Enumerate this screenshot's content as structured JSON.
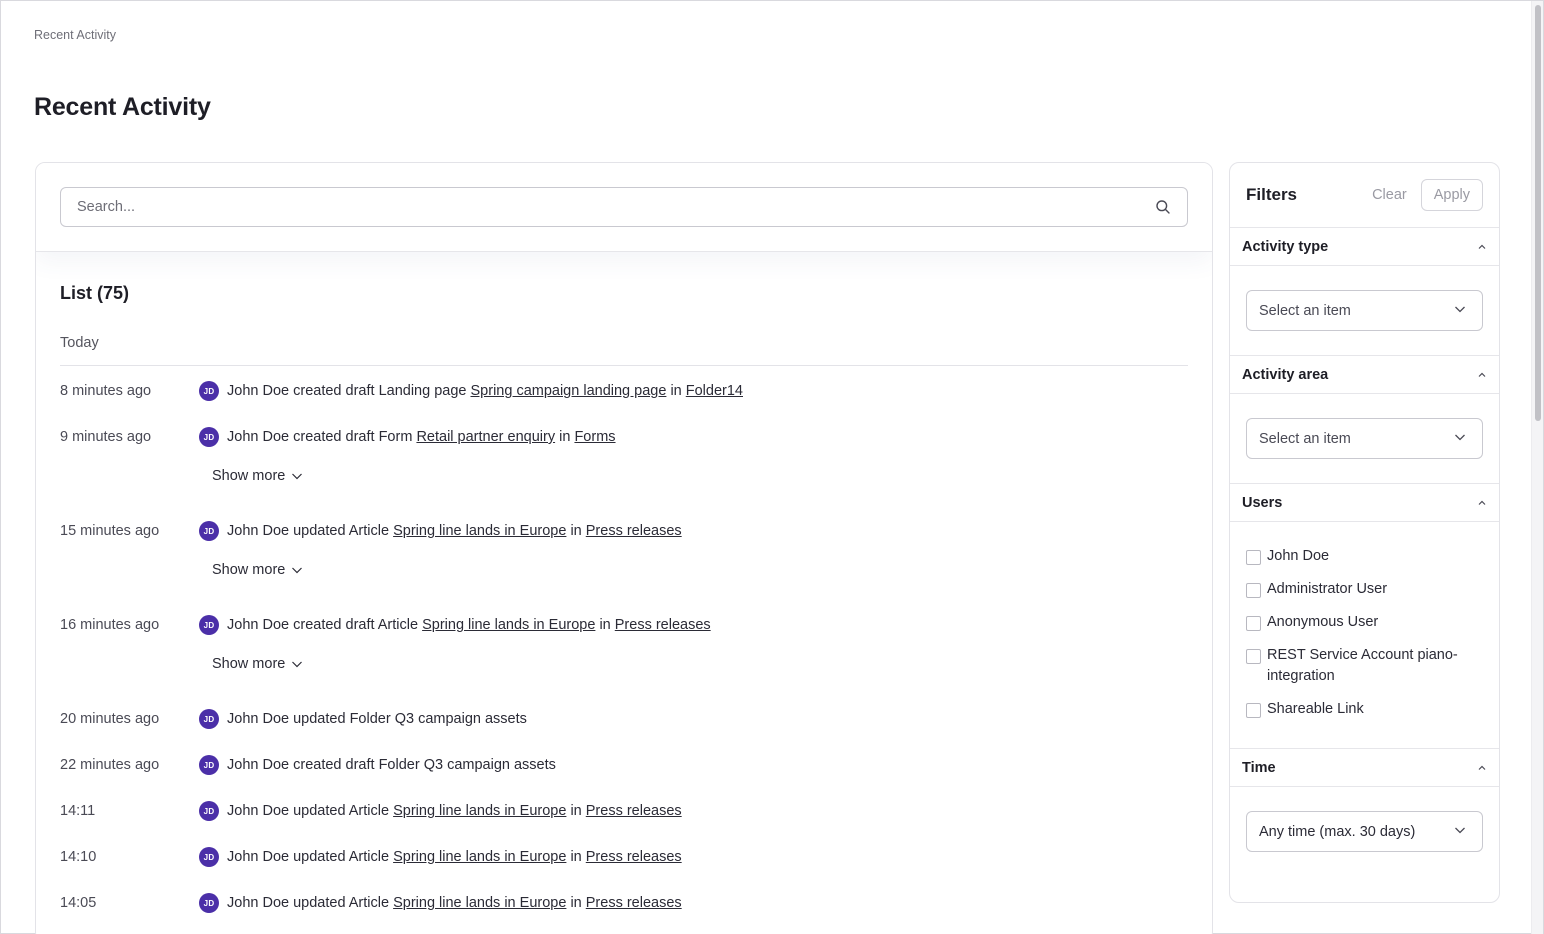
{
  "breadcrumb": "Recent Activity",
  "page_title": "Recent Activity",
  "search": {
    "placeholder": "Search..."
  },
  "list": {
    "title": "List (75)",
    "group": "Today",
    "rows": [
      {
        "time": "8 minutes ago",
        "avatar": "JD",
        "user": "John Doe",
        "action": "created draft",
        "type": "Landing page",
        "item": "Spring campaign landing page",
        "item_linked": true,
        "in": "in",
        "location": "Folder14"
      },
      {
        "time": "9 minutes ago",
        "avatar": "JD",
        "user": "John Doe",
        "action": "created draft",
        "type": "Form",
        "item": "Retail partner enquiry",
        "item_linked": true,
        "in": "in",
        "location": "Forms"
      },
      {
        "time": "15 minutes ago",
        "avatar": "JD",
        "user": "John Doe",
        "action": "updated",
        "type": "Article",
        "item": "Spring line lands in Europe",
        "item_linked": true,
        "in": "in",
        "location": "Press releases"
      },
      {
        "time": "16 minutes ago",
        "avatar": "JD",
        "user": "John Doe",
        "action": "created draft",
        "type": "Article",
        "item": "Spring line lands in Europe",
        "item_linked": true,
        "in": "in",
        "location": "Press releases"
      },
      {
        "time": "20 minutes ago",
        "avatar": "JD",
        "user": "John Doe",
        "action": "updated",
        "type": "Folder",
        "item": "Q3 campaign assets",
        "item_linked": false,
        "in": "",
        "location": ""
      },
      {
        "time": "22 minutes ago",
        "avatar": "JD",
        "user": "John Doe",
        "action": "created draft",
        "type": "Folder",
        "item": "Q3 campaign assets",
        "item_linked": false,
        "in": "",
        "location": ""
      },
      {
        "time": "14:11",
        "avatar": "JD",
        "user": "John Doe",
        "action": "updated",
        "type": "Article",
        "item": "Spring line lands in Europe",
        "item_linked": true,
        "in": "in",
        "location": "Press releases"
      },
      {
        "time": "14:10",
        "avatar": "JD",
        "user": "John Doe",
        "action": "updated",
        "type": "Article",
        "item": "Spring line lands in Europe",
        "item_linked": true,
        "in": "in",
        "location": "Press releases"
      },
      {
        "time": "14:05",
        "avatar": "JD",
        "user": "John Doe",
        "action": "updated",
        "type": "Article",
        "item": "Spring line lands in Europe",
        "item_linked": true,
        "in": "in",
        "location": "Press releases"
      }
    ],
    "show_more_label": "Show more"
  },
  "filters": {
    "title": "Filters",
    "clear_label": "Clear",
    "apply_label": "Apply",
    "activity_type": {
      "label": "Activity type",
      "value": "Select an item"
    },
    "activity_area": {
      "label": "Activity area",
      "value": "Select an item"
    },
    "users": {
      "label": "Users",
      "options": [
        "John Doe",
        "Administrator User",
        "Anonymous User",
        "REST Service Account piano-integration",
        "Shareable Link"
      ]
    },
    "time": {
      "label": "Time",
      "value": "Any time (max. 30 days)"
    }
  },
  "colors": {
    "avatar": "#4b2fa8",
    "text": "#2b2b36",
    "border": "#e3e3e8"
  },
  "icons": {
    "search": "search-icon",
    "chevron": "chevron-down-icon",
    "caret": "chevron-up-icon"
  }
}
